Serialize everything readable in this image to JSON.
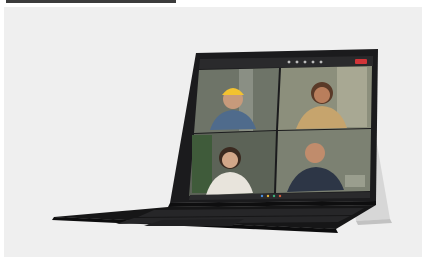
{
  "image": {
    "subject": "laptop-tablet-video-call",
    "colors": {
      "background": "#efefef",
      "device_body": "#1d1d1f",
      "keyboard": "#151515",
      "kickstand": "#d6d6d6",
      "call_bg": "#5b5f4f",
      "toolbar_accent": "#d13438"
    }
  }
}
